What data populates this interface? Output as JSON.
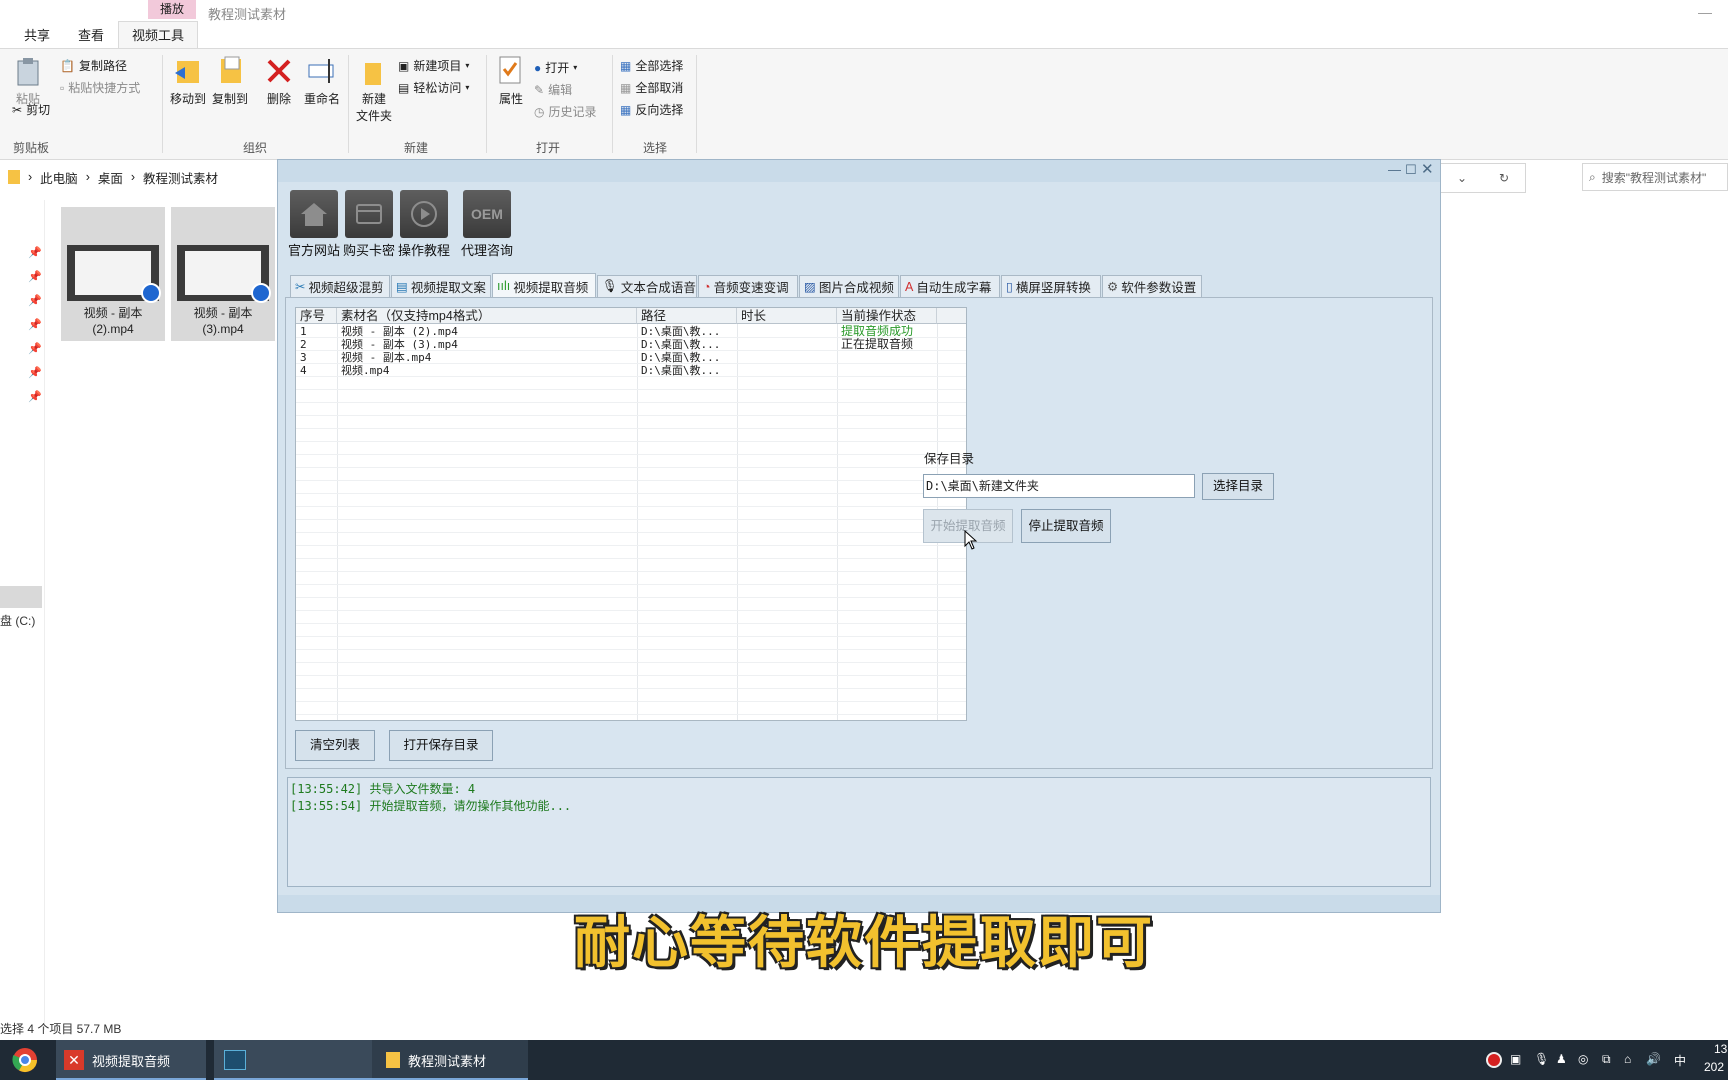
{
  "explorer": {
    "window_title": "教程测试素材",
    "context_header": "播放",
    "tabs": [
      "共享",
      "查看",
      "视频工具"
    ],
    "ribbon": {
      "clipboard": {
        "paste": "粘贴",
        "copy_path": "复制路径",
        "paste_shortcut": "粘贴快捷方式",
        "cut": "剪切",
        "group": "剪贴板"
      },
      "organize": {
        "move_to": "移动到",
        "copy_to": "复制到",
        "delete": "删除",
        "rename": "重命名",
        "group": "组织"
      },
      "new": {
        "new_folder_line1": "新建",
        "new_folder_line2": "文件夹",
        "new_item": "新建项目",
        "easy_access": "轻松访问",
        "group": "新建"
      },
      "open": {
        "properties": "属性",
        "open": "打开",
        "edit": "编辑",
        "history": "历史记录",
        "group": "打开"
      },
      "select": {
        "select_all": "全部选择",
        "select_none": "全部取消",
        "invert": "反向选择",
        "group": "选择"
      }
    },
    "breadcrumb": [
      "此电脑",
      "桌面",
      "教程测试素材"
    ],
    "search_placeholder": "搜索\"教程测试素材\"",
    "files": [
      {
        "line1": "视频 - 副本",
        "line2": "(2).mp4"
      },
      {
        "line1": "视频 - 副本",
        "line2": "(3).mp4"
      }
    ],
    "drive_label": "盘 (C:)",
    "status": "选择 4 个项目  57.7 MB"
  },
  "app": {
    "top_icons": [
      {
        "label": "官方网站",
        "icon": "home-icon"
      },
      {
        "label": "购买卡密",
        "icon": "card-icon"
      },
      {
        "label": "操作教程",
        "icon": "play-icon"
      },
      {
        "label": "代理咨询",
        "icon": "oem-icon",
        "glyph": "OEM"
      }
    ],
    "tabs": [
      "视频超级混剪",
      "视频提取文案",
      "视频提取音频",
      "文本合成语音",
      "音频变速变调",
      "图片合成视频",
      "自动生成字幕",
      "横屏竖屏转换",
      "软件参数设置"
    ],
    "active_tab": 2,
    "grid": {
      "headers": [
        "序号",
        "素材名（仅支持mp4格式）",
        "路径",
        "时长",
        "当前操作状态"
      ],
      "rows": [
        [
          "1",
          "视频 - 副本 (2).mp4",
          "D:\\桌面\\教...",
          "",
          "提取音频成功"
        ],
        [
          "2",
          "视频 - 副本 (3).mp4",
          "D:\\桌面\\教...",
          "",
          "正在提取音频"
        ],
        [
          "3",
          "视频 - 副本.mp4",
          "D:\\桌面\\教...",
          "",
          ""
        ],
        [
          "4",
          "视频.mp4",
          "D:\\桌面\\教...",
          "",
          ""
        ]
      ],
      "status_colors": {
        "success": "#2a9a2a",
        "working": "#111111"
      }
    },
    "save_dir_label": "保存目录",
    "save_dir_value": "D:\\桌面\\新建文件夹",
    "choose_dir_btn": "选择目录",
    "start_btn": "开始提取音频",
    "stop_btn": "停止提取音频",
    "clear_btn": "清空列表",
    "open_dir_btn": "打开保存目录",
    "log": [
      "[13:55:42] 共导入文件数量: 4",
      "[13:55:54] 开始提取音频，请勿操作其他功能..."
    ]
  },
  "subtitle": "耐心等待软件提取即可",
  "taskbar": {
    "items": [
      "视频提取音频",
      "",
      "教程测试素材"
    ],
    "ime": "中",
    "clock_partial": "13",
    "date_partial": "202"
  }
}
